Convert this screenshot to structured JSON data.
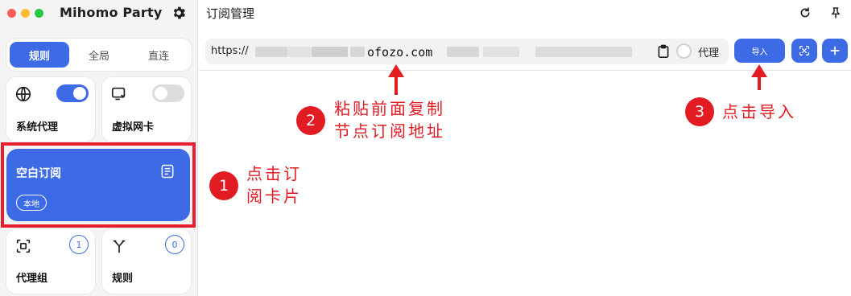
{
  "window": {
    "dots": [
      "#fe5f57",
      "#febc2e",
      "#28c840"
    ]
  },
  "app": {
    "title": "Mihomo Party",
    "settings_icon": "gear-icon"
  },
  "mode_tabs": [
    {
      "label": "规则",
      "active": true
    },
    {
      "label": "全局",
      "active": false
    },
    {
      "label": "直连",
      "active": false
    }
  ],
  "cards": {
    "system_proxy": {
      "label": "系统代理",
      "icon": "globe-icon",
      "enabled": true
    },
    "tun": {
      "label": "虚拟网卡",
      "icon": "network-card-icon",
      "enabled": false
    },
    "proxy_groups": {
      "label": "代理组",
      "icon": "group-icon",
      "count": "1"
    },
    "rules": {
      "label": "规则",
      "icon": "fork-icon",
      "count": "0"
    }
  },
  "subscription": {
    "name": "空白订阅",
    "badge": "本地",
    "icon": "document-icon"
  },
  "main": {
    "title": "订阅管理",
    "url_prefix": "https://",
    "url_domain": "ofozo.com",
    "proxy_label": "代理",
    "import_label": "导入"
  },
  "annotations": {
    "step1": {
      "num": "1",
      "text": "点击订\n阅卡片"
    },
    "step2": {
      "num": "2",
      "text": "粘贴前面复制\n节点订阅地址"
    },
    "step3": {
      "num": "3",
      "text": "点击导入"
    }
  },
  "colors": {
    "accent": "#3d6be5",
    "annotation": "#e31b23"
  }
}
